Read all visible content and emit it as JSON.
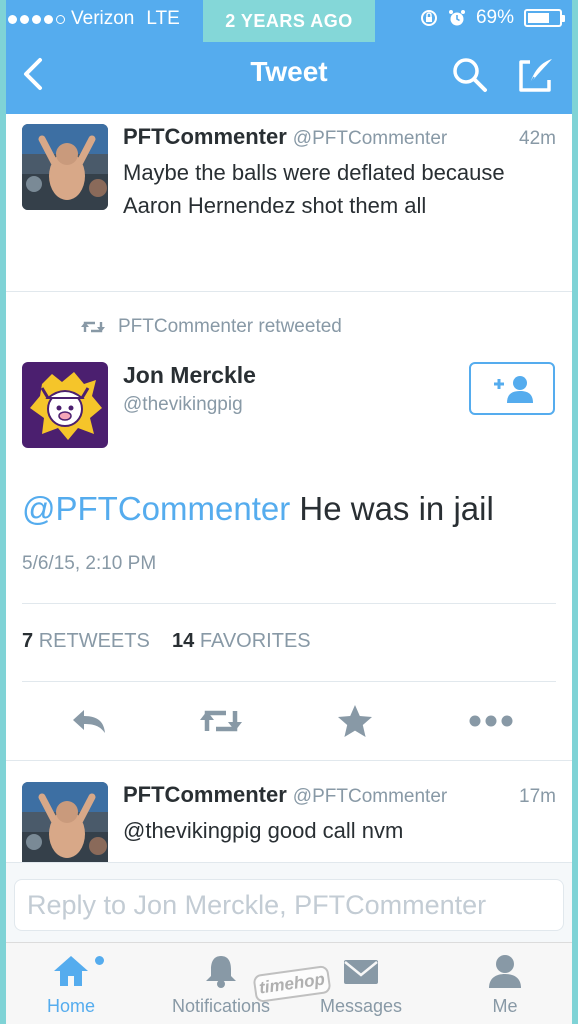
{
  "status_bar": {
    "carrier": "Verizon",
    "network": "LTE",
    "badge": "2 YEARS AGO",
    "battery": "69%",
    "battery_level": 0.69
  },
  "nav": {
    "title": "Tweet",
    "back_icon": "chevron-left-icon",
    "search_icon": "search-icon",
    "compose_icon": "compose-icon"
  },
  "tweets_above": [
    {
      "name": "PFTCommenter",
      "handle": "@PFTCommenter",
      "time": "42m",
      "text": "Maybe the balls were deflated because Aaron Hernendez shot them all"
    }
  ],
  "main_tweet": {
    "retweeted_by": "PFTCommenter retweeted",
    "name": "Jon Merckle",
    "handle": "@thevikingpig",
    "mention": "@PFTCommenter",
    "text": " He was in jail",
    "timestamp": "5/6/15, 2:10 PM",
    "retweets_count": "7",
    "retweets_label": "RETWEETS",
    "favorites_count": "14",
    "favorites_label": "FAVORITES",
    "actions": [
      "reply-icon",
      "retweet-icon",
      "star-icon",
      "more-icon"
    ]
  },
  "replies": [
    {
      "name": "PFTCommenter",
      "handle": "@PFTCommenter",
      "time": "17m",
      "text": "@thevikingpig good call nvm"
    }
  ],
  "reply_bar": {
    "placeholder": "Reply to Jon Merckle, PFTCommenter"
  },
  "tabbar": {
    "tabs": [
      {
        "label": "Home",
        "icon": "home-icon",
        "active": true
      },
      {
        "label": "Notifications",
        "icon": "bell-icon",
        "active": false
      },
      {
        "label": "Messages",
        "icon": "envelope-icon",
        "active": false
      },
      {
        "label": "Me",
        "icon": "person-icon",
        "active": false
      }
    ]
  },
  "watermark": "timehop",
  "colors": {
    "brand": "#55acee",
    "frame": "#7fd3d6"
  }
}
